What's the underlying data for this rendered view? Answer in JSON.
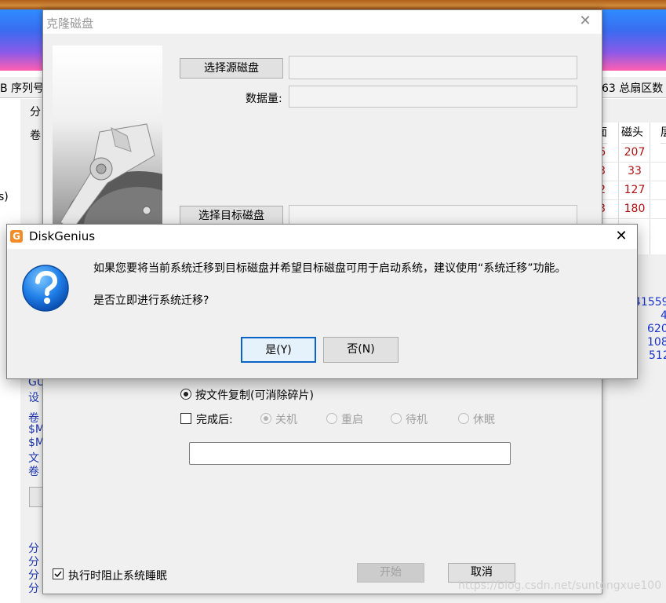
{
  "background": {
    "header_fragment_left": "B 序列号",
    "header_fragment_right": "63 总扇区数",
    "left_char": "分",
    "left_char2": "卷",
    "left_edge_char": "s)",
    "table_headers": [
      "面",
      "磁头",
      "层"
    ],
    "table_rows": [
      {
        "c1": "6",
        "c2": "207"
      },
      {
        "c1": "3",
        "c2": "33"
      },
      {
        "c1": "2",
        "c2": "127"
      },
      {
        "c1": "3",
        "c2": "180"
      }
    ],
    "right_numbers": [
      "41559",
      "4",
      "620",
      "108",
      "512"
    ],
    "mid_labels": [
      "GU",
      "设"
    ],
    "lower_labels": [
      "卷",
      "$M",
      "$M",
      "文",
      "卷"
    ],
    "bottom_labels": [
      "分",
      "分",
      "分",
      "分"
    ]
  },
  "clone_dialog": {
    "title": "克隆磁盘",
    "select_source_button": "选择源磁盘",
    "data_amount_label": "数据量:",
    "select_target_button": "选择目标磁盘",
    "copy_by_file_option": "按文件复制(可消除碎片)",
    "after_complete_label": "完成后:",
    "after_options": [
      "关机",
      "重启",
      "待机",
      "休眠"
    ],
    "prevent_sleep_label": "执行时阻止系统睡眠",
    "start_button": "开始",
    "cancel_button": "取消"
  },
  "message_box": {
    "title": "DiskGenius",
    "logo_letter": "G",
    "line1": "如果您要将当前系统迁移到目标磁盘并希望目标磁盘可用于启动系统，建议使用“系统迁移”功能。",
    "line2": "是否立即进行系统迁移?",
    "yes_button": "是(Y)",
    "no_button": "否(N)"
  },
  "watermark": "https://blog.csdn.net/suntongxue100"
}
